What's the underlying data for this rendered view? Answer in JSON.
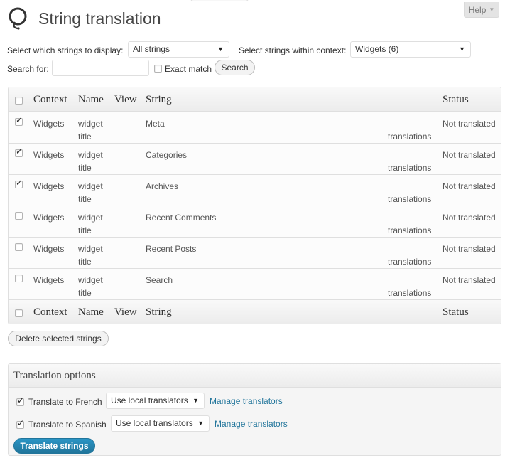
{
  "header": {
    "title": "String translation",
    "help_label": "Help",
    "help_arrow": "▼"
  },
  "filters": {
    "display_label": "Select which strings to display:",
    "display_value": "All strings",
    "context_label": "Select strings within context:",
    "context_value": "Widgets (6)",
    "search_label": "Search for:",
    "search_value": "",
    "exact_match_label": "Exact match",
    "exact_match_checked": false,
    "search_button": "Search"
  },
  "table": {
    "columns": [
      "Context",
      "Name",
      "View",
      "String",
      "Status"
    ],
    "translations_link": "translations",
    "rows": [
      {
        "checked": true,
        "context": "Widgets",
        "name1": "widget",
        "name2": "title",
        "string": "Meta",
        "status": "Not translated"
      },
      {
        "checked": true,
        "context": "Widgets",
        "name1": "widget",
        "name2": "title",
        "string": "Categories",
        "status": "Not translated"
      },
      {
        "checked": true,
        "context": "Widgets",
        "name1": "widget",
        "name2": "title",
        "string": "Archives",
        "status": "Not translated"
      },
      {
        "checked": false,
        "context": "Widgets",
        "name1": "widget",
        "name2": "title",
        "string": "Recent Comments",
        "status": "Not translated"
      },
      {
        "checked": false,
        "context": "Widgets",
        "name1": "widget",
        "name2": "title",
        "string": "Recent Posts",
        "status": "Not translated"
      },
      {
        "checked": false,
        "context": "Widgets",
        "name1": "widget",
        "name2": "title",
        "string": "Search",
        "status": "Not translated"
      }
    ]
  },
  "delete_button": "Delete selected strings",
  "options": {
    "title": "Translation options",
    "rows": [
      {
        "checked": true,
        "label": "Translate to French",
        "select_value": "Use local translators",
        "manage_link": "Manage translators"
      },
      {
        "checked": true,
        "label": "Translate to Spanish",
        "select_value": "Use local translators",
        "manage_link": "Manage translators"
      }
    ],
    "submit_button": "Translate strings"
  },
  "colors": {
    "link": "#21759b",
    "primary_button": "#21759b",
    "border": "#dfdfdf"
  }
}
